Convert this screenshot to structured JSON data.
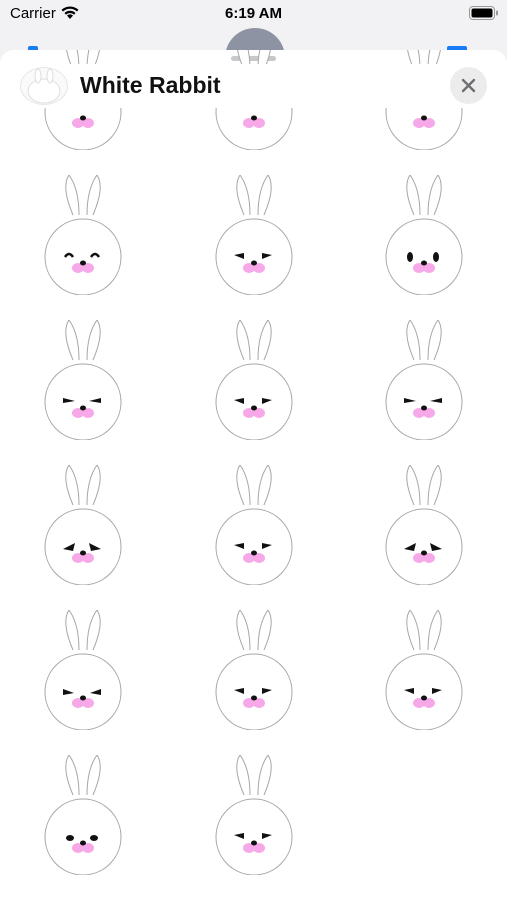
{
  "status_bar": {
    "carrier": "Carrier",
    "time": "6:19 AM"
  },
  "sheet": {
    "title": "White Rabbit",
    "close_icon": "xmark-icon"
  },
  "colors": {
    "nose": "#f7a8e8",
    "outline": "#a6a6a6",
    "eyes": "#111111"
  },
  "stickers": [
    {
      "id": 1,
      "expression": "partial"
    },
    {
      "id": 2,
      "expression": "partial"
    },
    {
      "id": 3,
      "expression": "partial"
    },
    {
      "id": 4,
      "expression": "happy"
    },
    {
      "id": 5,
      "expression": "angry"
    },
    {
      "id": 6,
      "expression": "crying"
    },
    {
      "id": 7,
      "expression": "smug"
    },
    {
      "id": 8,
      "expression": "angry"
    },
    {
      "id": 9,
      "expression": "smug"
    },
    {
      "id": 10,
      "expression": "worried"
    },
    {
      "id": 11,
      "expression": "angry"
    },
    {
      "id": 12,
      "expression": "worried"
    },
    {
      "id": 13,
      "expression": "wink"
    },
    {
      "id": 14,
      "expression": "angry"
    },
    {
      "id": 15,
      "expression": "angry"
    },
    {
      "id": 16,
      "expression": "neutral"
    },
    {
      "id": 17,
      "expression": "angry"
    }
  ]
}
